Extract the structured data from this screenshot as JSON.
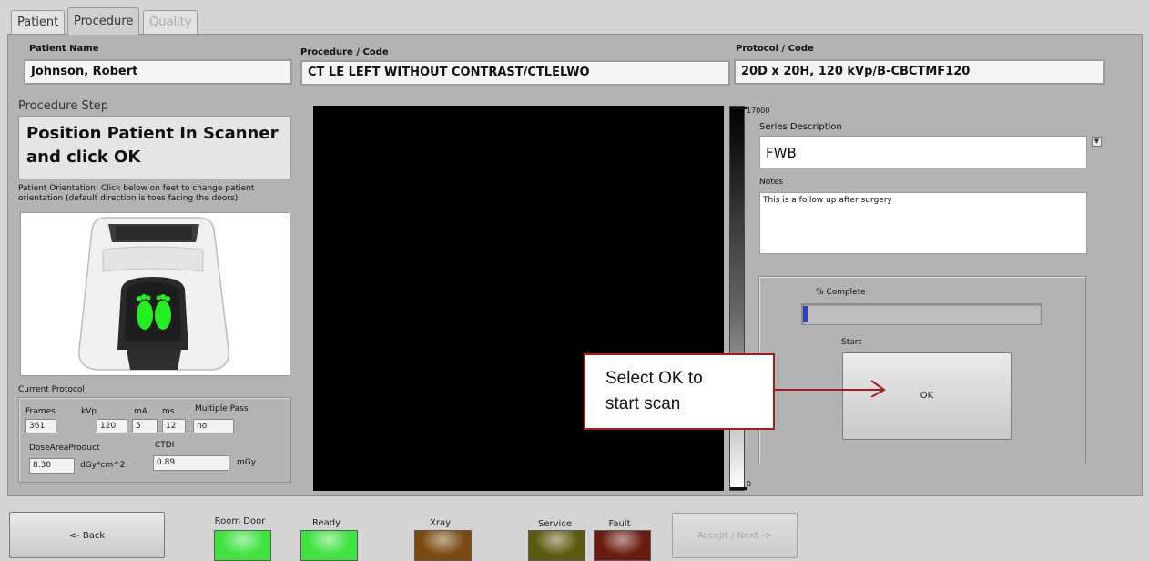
{
  "tabs": [
    {
      "label": "Patient"
    },
    {
      "label": "Procedure"
    },
    {
      "label": "Quality"
    }
  ],
  "header": {
    "patient_name_label": "Patient Name",
    "patient_name": "Johnson, Robert",
    "procedure_label": "Procedure / Code",
    "procedure_value": "CT LE LEFT WITHOUT CONTRAST/CTLELWO",
    "protocol_label": "Protocol / Code",
    "protocol_value": "20D x 20H, 120 kVp/B-CBCTMF120"
  },
  "procedure_step": {
    "label": "Procedure Step",
    "text_line1": "Position Patient In Scanner",
    "text_line2": "and click OK",
    "orientation_line1": "Patient Orientation: Click below on feet to change patient",
    "orientation_line2": "orientation (default direction is toes facing the doors)."
  },
  "current_protocol": {
    "label": "Current Protocol",
    "frames_label": "Frames",
    "frames": "361",
    "kvp_label": "kVp",
    "kvp": "120",
    "ma_label": "mA",
    "ma": "5",
    "ms_label": "ms",
    "ms": "12",
    "multipass_label": "Multiple Pass",
    "multipass": "no",
    "dap_label": "DoseAreaProduct",
    "dap": "8.30",
    "dap_unit": "dGy*cm^2",
    "ctdi_label": "CTDI",
    "ctdi": "0.89",
    "ctdi_unit": "mGy"
  },
  "scale": {
    "max": "17000",
    "min": "0"
  },
  "series": {
    "label": "Series Description",
    "value": "FWB"
  },
  "notes": {
    "label": "Notes",
    "value": "This is a follow up after surgery"
  },
  "progress": {
    "label": "% Complete",
    "value": 0.02
  },
  "start": {
    "label": "Start",
    "ok_label": "OK"
  },
  "callout": {
    "line1": "Select OK to",
    "line2": "start scan"
  },
  "footer": {
    "back_label": "<- Back",
    "next_label": "Accept / Next ->",
    "indicators": [
      {
        "label": "Room Door",
        "color": "#3fe23f"
      },
      {
        "label": "Ready",
        "color": "#3fe23f"
      },
      {
        "label": "Xray",
        "color": "#7a4a12"
      },
      {
        "label": "Service",
        "color": "#5c5a10"
      },
      {
        "label": "Fault",
        "color": "#6a1c10"
      }
    ]
  }
}
